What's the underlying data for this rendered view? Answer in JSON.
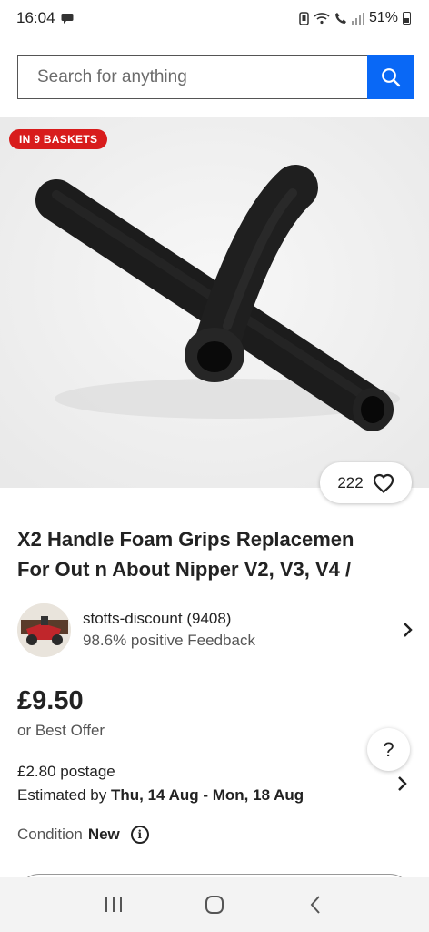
{
  "status_bar": {
    "time": "16:04",
    "battery_percent": "51%",
    "icons": [
      "chat-bubble-icon",
      "nfc-icon",
      "wifi-icon",
      "call-icon",
      "signal-icon",
      "battery-icon"
    ]
  },
  "search": {
    "placeholder": "Search for anything",
    "button_icon": "search-icon"
  },
  "listing": {
    "badge": "IN 9 BASKETS",
    "watchers": "222",
    "title_line1": "X2 Handle Foam Grips Replacemen",
    "title_line2": "For Out n About Nipper V2, V3, V4 /",
    "image": "black foam handle grips"
  },
  "seller": {
    "name": "stotts-discount (9408)",
    "feedback": "98.6% positive Feedback"
  },
  "price": {
    "amount": "£9.50",
    "offer": "or Best Offer"
  },
  "postage": {
    "price": "£2.80 postage",
    "estimated_label": "Estimated by",
    "estimated_dates": "Thu, 14 Aug - Mon, 18 Aug"
  },
  "condition": {
    "label": "Condition",
    "value": "New"
  },
  "help": {
    "label": "?"
  },
  "colors": {
    "accent": "#0968f6",
    "badge": "#d81c1c"
  }
}
